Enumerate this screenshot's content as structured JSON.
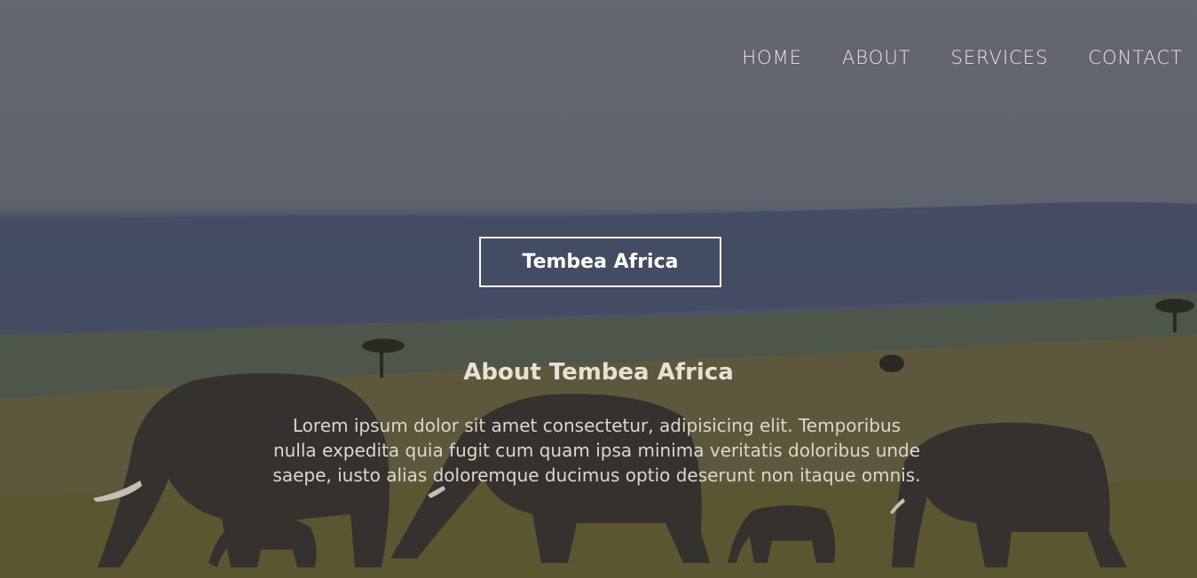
{
  "nav": {
    "items": [
      "HOME",
      "ABOUT",
      "SERVICES",
      "CONTACT"
    ]
  },
  "hero": {
    "brand": "Tembea Africa",
    "about_title": "About Tembea Africa",
    "about_text": "Lorem ipsum dolor sit amet consectetur, adipisicing elit. Temporibus nulla expedita quia fugit cum quam ipsa minima veritatis doloribus unde saepe, iusto alias doloremque ducimus optio deserunt non itaque omnis."
  },
  "colors": {
    "nav_text": "#e6e6e6",
    "brand_border": "#ffffff",
    "title_text": "#e9e0d4"
  }
}
